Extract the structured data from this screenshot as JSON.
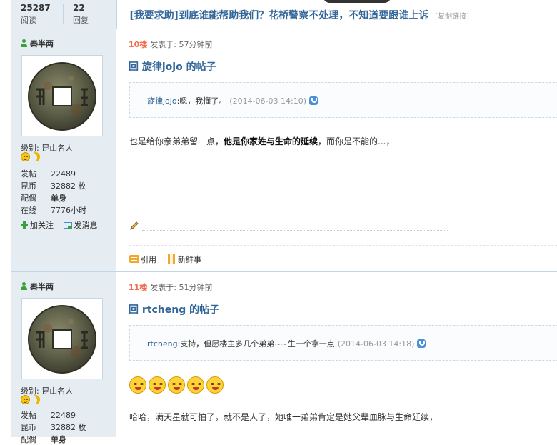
{
  "header": {
    "views_count": "25287",
    "views_label": "阅读",
    "replies_count": "22",
    "replies_label": "回复",
    "thread_title": "[我要求助]到底谁能帮助我们？花桥警察不处理，不知道要跟谁上诉",
    "copy_link": "[复制链接]"
  },
  "posts": [
    {
      "author": "秦半两",
      "level_label": "级别: 昆山名人",
      "stats": [
        {
          "k": "发帖",
          "v": "22489"
        },
        {
          "k": "昆币",
          "v": "32882 枚"
        },
        {
          "k": "配偶",
          "v": "单身"
        },
        {
          "k": "在线",
          "v": "7776小时"
        }
      ],
      "follow_label": "加关注",
      "message_label": "发消息",
      "floor": "10楼",
      "posted": "发表于: 57分钟前",
      "reply_title": "回 旋律jojo 的帖子",
      "quote_user": "旋律jojo",
      "quote_text": ":嗯，我懂了。",
      "quote_time": "(2014-06-03 14:10)",
      "body_before": "也是给你亲弟弟留一点，",
      "body_bold": "他是你家姓与生命的延续",
      "body_after": "，而你是不能的...，",
      "quote_btn": "引用",
      "news_btn": "新鲜事"
    },
    {
      "author": "秦半两",
      "level_label": "级别: 昆山名人",
      "stats": [
        {
          "k": "发帖",
          "v": "22489"
        },
        {
          "k": "昆币",
          "v": "32882 枚"
        },
        {
          "k": "配偶",
          "v": "单身"
        }
      ],
      "floor": "11楼",
      "posted": "发表于: 51分钟前",
      "reply_title": "回 rtcheng 的帖子",
      "quote_user": "rtcheng",
      "quote_text": ":支持，但愿楼主多几个弟弟~~生一个拿一点",
      "quote_time": "(2014-06-03 14:18)",
      "body": "哈哈，满天星就可怕了，就不是人了，她唯一弟弟肯定是她父辈血脉与生命延续，"
    }
  ],
  "colors": {
    "title_blue": "#336699",
    "floor_orange": "#f26c4f",
    "sidebar_bg": "#e5edf2",
    "border": "#c2d5e3"
  }
}
